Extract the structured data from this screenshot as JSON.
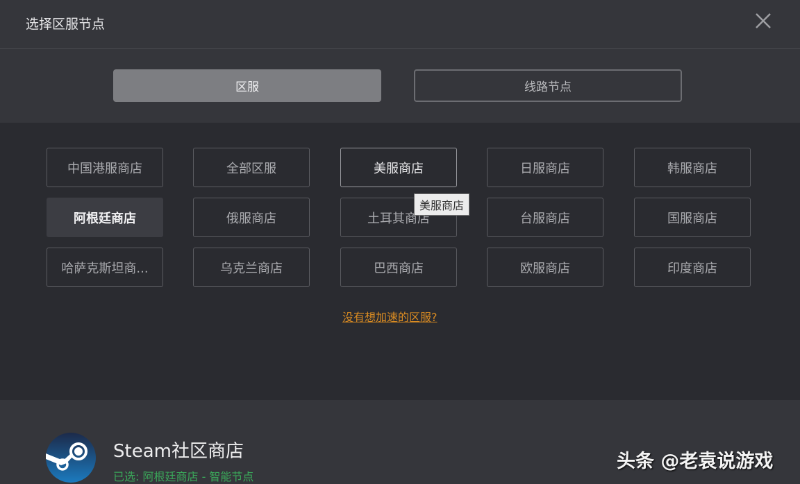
{
  "dialog": {
    "title": "选择区服节点"
  },
  "tabs": [
    {
      "label": "区服",
      "active": true
    },
    {
      "label": "线路节点",
      "active": false
    }
  ],
  "stores": [
    "中国港服商店",
    "全部区服",
    "美服商店",
    "日服商店",
    "韩服商店",
    "阿根廷商店",
    "俄服商店",
    "土耳其商店",
    "台服商店",
    "国服商店",
    "哈萨克斯坦商...",
    "乌克兰商店",
    "巴西商店",
    "欧服商店",
    "印度商店"
  ],
  "hovered_store": "美服商店",
  "selected_store": "阿根廷商店",
  "tooltip": "美服商店",
  "missing_link": "没有想加速的区服?",
  "footer": {
    "app_name": "Steam社区商店",
    "status": "已选: 阿根廷商店 - 智能节点"
  },
  "watermark": "头条 @老袁说游戏",
  "colors": {
    "accent_link": "#d98b22",
    "status_green": "#3aa85a",
    "background": "#2a2b30"
  }
}
